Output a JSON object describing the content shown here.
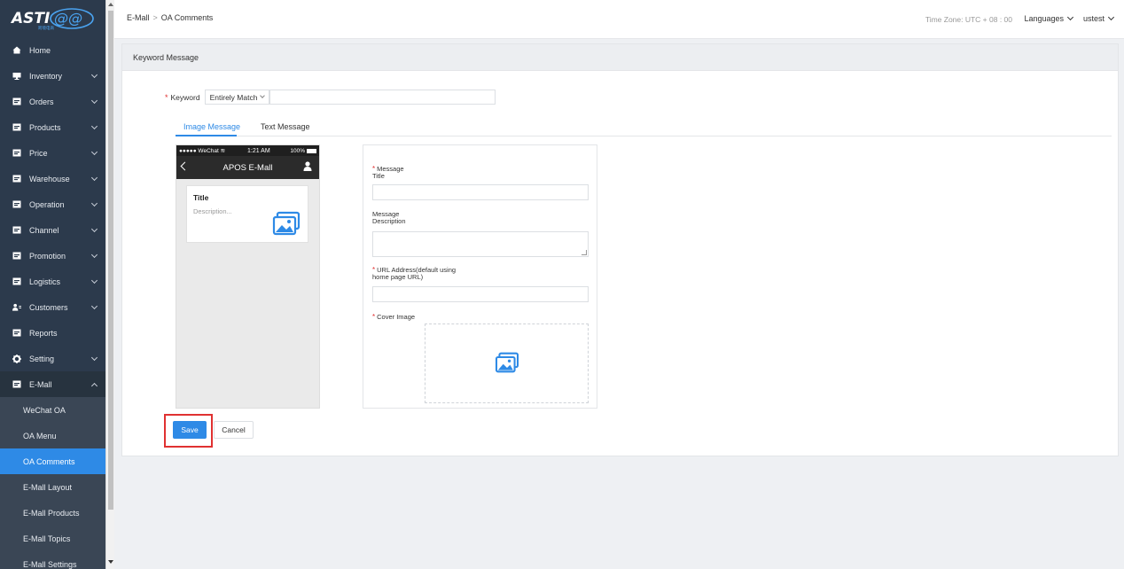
{
  "app": {
    "logo_text": "ASTI@@",
    "logo_subtext": "跨境电商"
  },
  "sidebar": {
    "items": [
      {
        "label": "Home",
        "icon": "home-icon",
        "expandable": false
      },
      {
        "label": "Inventory",
        "icon": "monitor-icon",
        "expandable": true
      },
      {
        "label": "Orders",
        "icon": "orders-icon",
        "expandable": true
      },
      {
        "label": "Products",
        "icon": "products-icon",
        "expandable": true
      },
      {
        "label": "Price",
        "icon": "price-icon",
        "expandable": true
      },
      {
        "label": "Warehouse",
        "icon": "warehouse-icon",
        "expandable": true
      },
      {
        "label": "Operation",
        "icon": "operation-icon",
        "expandable": true
      },
      {
        "label": "Channel",
        "icon": "channel-icon",
        "expandable": true
      },
      {
        "label": "Promotion",
        "icon": "promotion-icon",
        "expandable": true
      },
      {
        "label": "Logistics",
        "icon": "logistics-icon",
        "expandable": true
      },
      {
        "label": "Customers",
        "icon": "customers-icon",
        "expandable": true
      },
      {
        "label": "Reports",
        "icon": "reports-icon",
        "expandable": false
      },
      {
        "label": "Setting",
        "icon": "gear-icon",
        "expandable": true
      },
      {
        "label": "E-Mall",
        "icon": "emall-icon",
        "expandable": true,
        "open": true
      }
    ],
    "sub_items": [
      {
        "label": "WeChat OA",
        "active": false
      },
      {
        "label": "OA Menu",
        "active": false
      },
      {
        "label": "OA Comments",
        "active": true
      },
      {
        "label": "E-Mall Layout",
        "active": false
      },
      {
        "label": "E-Mall Products",
        "active": false
      },
      {
        "label": "E-Mall Topics",
        "active": false
      },
      {
        "label": "E-Mall Settings",
        "active": false
      }
    ]
  },
  "topbar": {
    "breadcrumb_parent": "E-Mall",
    "breadcrumb_sep": ">",
    "breadcrumb_current": "OA Comments",
    "timezone": "Time Zone: UTC + 08 : 00",
    "languages": "Languages",
    "user": "ustest"
  },
  "panel": {
    "title": "Keyword Message",
    "keyword_label": "Keyword",
    "keyword_match": "Entirely Match",
    "keyword_value": "",
    "tabs": [
      {
        "label": "Image Message",
        "active": true
      },
      {
        "label": "Text Message",
        "active": false
      }
    ]
  },
  "phone": {
    "carrier": "●●●●● WeChat",
    "time": "1:21 AM",
    "battery": "100%",
    "nav_title": "APOS E-Mall",
    "card_title": "Title",
    "card_desc": "Description..."
  },
  "form": {
    "title_label_1": "Message",
    "title_label_2": "Title",
    "desc_label_1": "Message",
    "desc_label_2": "Description",
    "url_label_1": "URL Address(default using",
    "url_label_2": "home page URL)",
    "cover_label": "Cover Image"
  },
  "actions": {
    "save": "Save",
    "cancel": "Cancel"
  },
  "colors": {
    "accent": "#2e8ae6",
    "sidebar_bg": "#2c3a4c",
    "required": "#e03131"
  }
}
